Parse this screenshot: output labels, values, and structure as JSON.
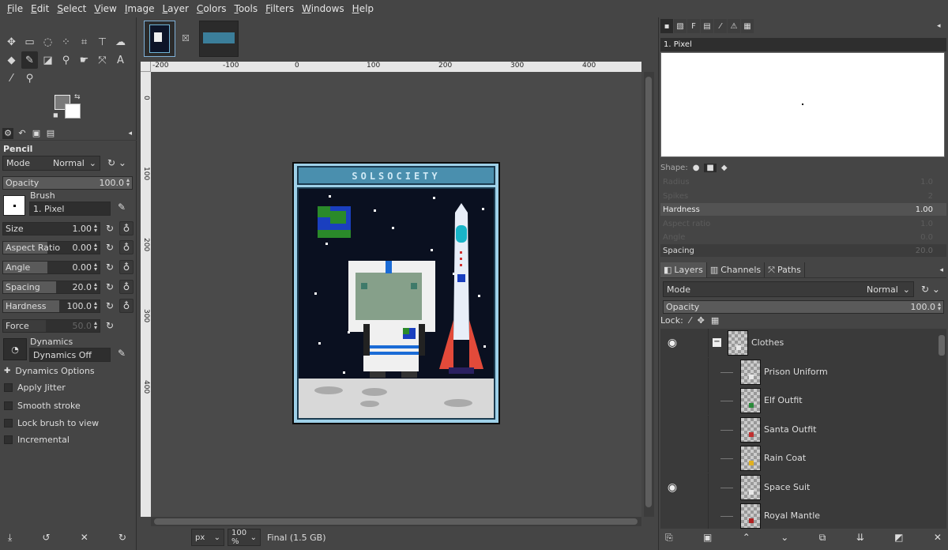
{
  "menu": [
    "File",
    "Edit",
    "Select",
    "View",
    "Image",
    "Layer",
    "Colors",
    "Tools",
    "Filters",
    "Windows",
    "Help"
  ],
  "tool_options": {
    "tool_name": "Pencil",
    "mode_label": "Mode",
    "mode_value": "Normal",
    "opacity_label": "Opacity",
    "opacity_value": "100.0",
    "brush_label": "Brush",
    "brush_value": "1. Pixel",
    "size_label": "Size",
    "size_value": "1.00",
    "aspect_label": "Aspect Ratio",
    "aspect_value": "0.00",
    "angle_label": "Angle",
    "angle_value": "0.00",
    "spacing_label": "Spacing",
    "spacing_value": "20.0",
    "hardness_label": "Hardness",
    "hardness_value": "100.0",
    "force_label": "Force",
    "force_value": "50.0",
    "dynamics_label": "Dynamics",
    "dynamics_value": "Dynamics Off",
    "dynamics_options": "Dynamics Options",
    "apply_jitter": "Apply Jitter",
    "smooth_stroke": "Smooth stroke",
    "lock_brush": "Lock brush to view",
    "incremental": "Incremental"
  },
  "rulers": {
    "h_ticks": [
      "-200",
      "-100",
      "0",
      "100",
      "200",
      "300",
      "400"
    ],
    "v_ticks": [
      "0",
      "100",
      "200",
      "300",
      "400"
    ]
  },
  "artwork": {
    "banner": "SOLSOCIETY"
  },
  "status": {
    "unit": "px",
    "zoom": "100 %",
    "info": "Final (1.5 GB)"
  },
  "brushes_panel": {
    "brush_name": "1. Pixel",
    "shape_label": "Shape:",
    "radius_label": "Radius",
    "radius_value": "1.0",
    "spikes_label": "Spikes",
    "spikes_value": "2",
    "hardness_label": "Hardness",
    "hardness_value": "1.00",
    "aspect_label": "Aspect ratio",
    "aspect_value": "1.0",
    "angle_label": "Angle",
    "angle_value": "0.0",
    "spacing_label": "Spacing",
    "spacing_value": "20.0"
  },
  "layers_panel": {
    "tabs": [
      "Layers",
      "Channels",
      "Paths"
    ],
    "mode_label": "Mode",
    "mode_value": "Normal",
    "opacity_label": "Opacity",
    "opacity_value": "100.0",
    "lock_label": "Lock:",
    "layers": [
      {
        "name": "Clothes",
        "visible": true,
        "group": true,
        "color": "#e8e8e8"
      },
      {
        "name": "Prison Uniform",
        "visible": false,
        "group": false,
        "color": "#e8e8e8"
      },
      {
        "name": "Elf Outfit",
        "visible": false,
        "group": false,
        "color": "#2a8a3a"
      },
      {
        "name": "Santa Outfit",
        "visible": false,
        "group": false,
        "color": "#c03030"
      },
      {
        "name": "Rain Coat",
        "visible": false,
        "group": false,
        "color": "#e0b020"
      },
      {
        "name": "Space Suit",
        "visible": true,
        "group": false,
        "color": "#e8e8e8"
      },
      {
        "name": "Royal Mantle",
        "visible": false,
        "group": false,
        "color": "#b02020"
      }
    ]
  }
}
